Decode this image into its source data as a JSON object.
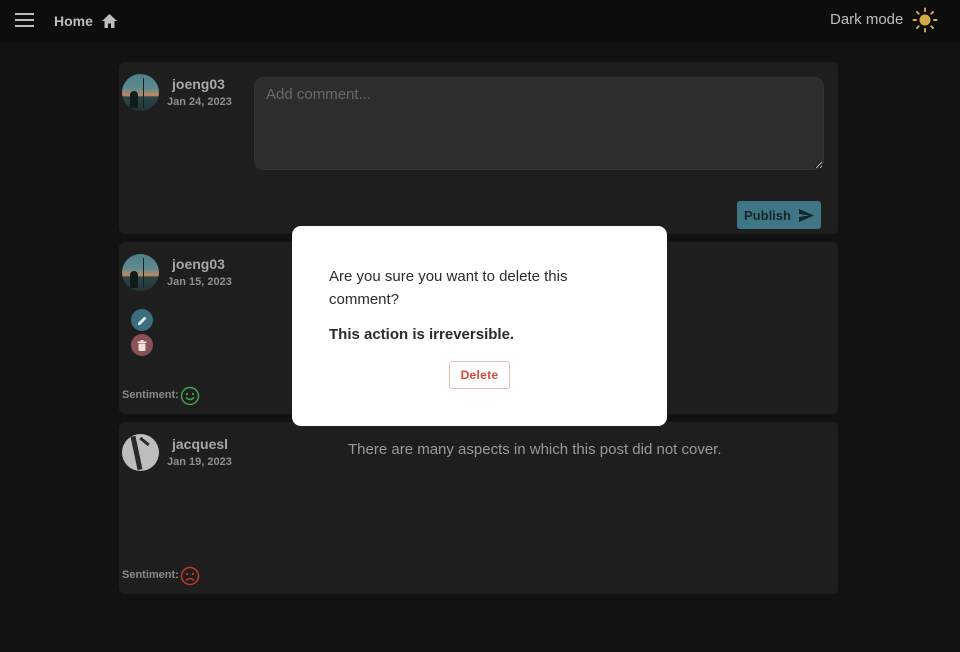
{
  "topbar": {
    "menu_icon": "hamburger-menu-icon",
    "home_label": "Home",
    "home_icon": "home-icon",
    "dark_mode_label": "Dark mode",
    "theme_icon": "sun-icon"
  },
  "new_comment": {
    "username": "joeng03",
    "date": "Jan 24, 2023",
    "placeholder": "Add comment...",
    "publish_label": "Publish",
    "publish_icon": "send-icon"
  },
  "comments": [
    {
      "username": "joeng03",
      "date": "Jan 15, 2023",
      "text": "",
      "sentiment_label": "Sentiment:",
      "sentiment_icon": "smiley-icon",
      "sentiment_color": "#3fa34d"
    },
    {
      "username": "jacquesl",
      "date": "Jan 19, 2023",
      "text": "There are many aspects in which this post did not cover.",
      "sentiment_label": "Sentiment:",
      "sentiment_icon": "frown-icon",
      "sentiment_color": "#c0392b"
    }
  ],
  "dialog": {
    "message": "Are you sure you want to delete this comment?",
    "warning": "This action is irreversible.",
    "delete_label": "Delete"
  },
  "colors": {
    "background": "#121212",
    "card": "#1e1e1e",
    "accent": "#3f7685",
    "danger": "#d6453a"
  }
}
